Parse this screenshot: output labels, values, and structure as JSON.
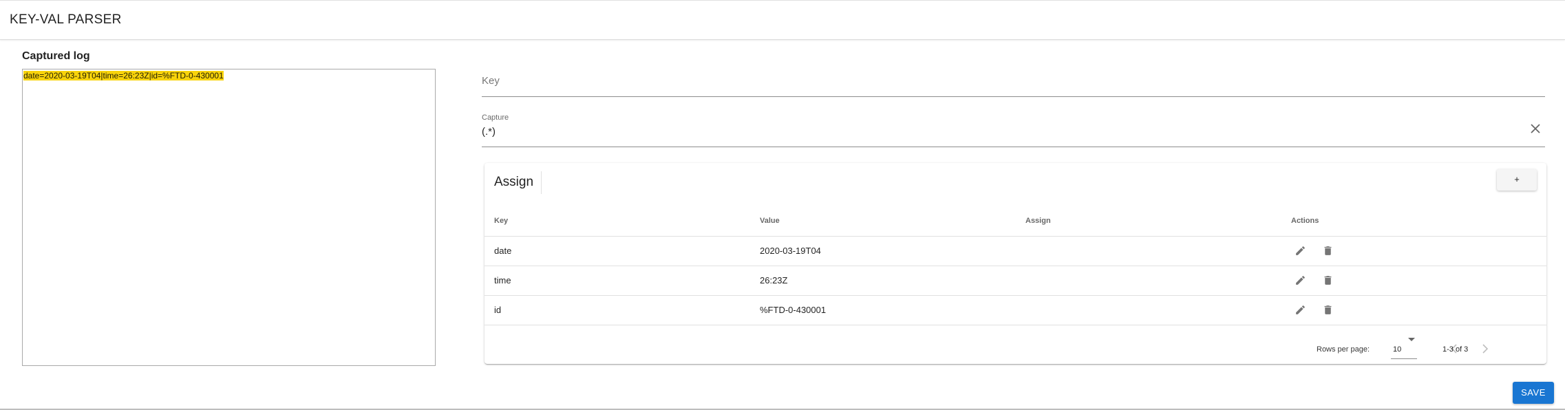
{
  "app": {
    "title": "KEY-VAL PARSER"
  },
  "log": {
    "heading": "Captured log",
    "content": "date=2020-03-19T04|time=26:23Z|id=%FTD-0-430001",
    "highlight_color": "#f8d30c"
  },
  "key_field": {
    "placeholder": "Key",
    "value": ""
  },
  "capture_field": {
    "label": "Capture",
    "value": "(.*)",
    "clear_icon": "close-icon"
  },
  "assign_table": {
    "title": "Assign",
    "add_label": "+",
    "columns": [
      "Key",
      "Value",
      "Assign",
      "Actions"
    ],
    "rows": [
      {
        "key": "date",
        "value": "2020-03-19T04",
        "assign": ""
      },
      {
        "key": "time",
        "value": "26:23Z",
        "assign": ""
      },
      {
        "key": "id",
        "value": "%FTD-0-430001",
        "assign": ""
      }
    ],
    "row_action_icons": [
      "edit-icon",
      "delete-icon"
    ],
    "pagination": {
      "rows_per_page_label": "Rows per page:",
      "rows_per_page": "10",
      "range": "1-3 of 3",
      "prev_icon": "chevron-left-icon",
      "next_icon": "chevron-right-icon"
    }
  },
  "save_label": "SAVE",
  "colors": {
    "primary": "#1976d2"
  }
}
